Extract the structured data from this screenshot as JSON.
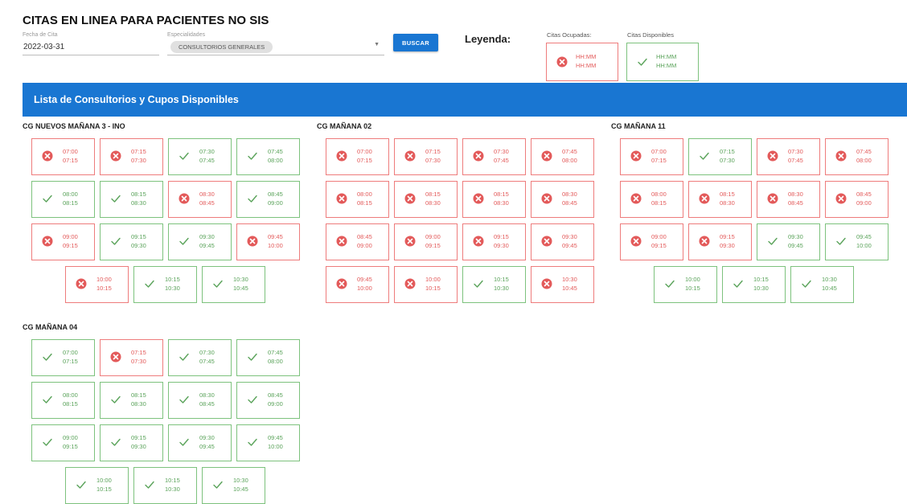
{
  "page": {
    "title": "CITAS EN LINEA PARA PACIENTES NO SIS"
  },
  "filters": {
    "date_label": "Fecha de Cita",
    "date_value": "2022-03-31",
    "specialty_label": "Especialidades",
    "specialty_value": "CONSULTORIOS GENERALES",
    "search_label": "BUSCAR"
  },
  "legend": {
    "title": "Leyenda:",
    "occupied_label": "Citas Ocupadas:",
    "occupied_start": "HH:MM",
    "occupied_end": "HH:MM",
    "available_label": "Citas Disponibles",
    "available_start": "HH:MM",
    "available_end": "HH:MM"
  },
  "banner": {
    "title": "Lista de Consultorios y Cupos Disponibles"
  },
  "colors": {
    "primary": "#1976d2",
    "occupied": "#e35a5a",
    "available": "#5aa35a"
  },
  "icons": {
    "occupied": "close-circle-icon",
    "available": "check-icon"
  },
  "groups": [
    {
      "name": "CG NUEVOS MAÑANA 3 - INO",
      "slots": [
        {
          "start": "07:00",
          "end": "07:15",
          "status": "occupied"
        },
        {
          "start": "07:15",
          "end": "07:30",
          "status": "occupied"
        },
        {
          "start": "07:30",
          "end": "07:45",
          "status": "available"
        },
        {
          "start": "07:45",
          "end": "08:00",
          "status": "available"
        },
        {
          "start": "08:00",
          "end": "08:15",
          "status": "available"
        },
        {
          "start": "08:15",
          "end": "08:30",
          "status": "available"
        },
        {
          "start": "08:30",
          "end": "08:45",
          "status": "occupied"
        },
        {
          "start": "08:45",
          "end": "09:00",
          "status": "available"
        },
        {
          "start": "09:00",
          "end": "09:15",
          "status": "occupied"
        },
        {
          "start": "09:15",
          "end": "09:30",
          "status": "available"
        },
        {
          "start": "09:30",
          "end": "09:45",
          "status": "available"
        },
        {
          "start": "09:45",
          "end": "10:00",
          "status": "occupied"
        },
        {
          "start": "10:00",
          "end": "10:15",
          "status": "occupied"
        },
        {
          "start": "10:15",
          "end": "10:30",
          "status": "available"
        },
        {
          "start": "10:30",
          "end": "10:45",
          "status": "available"
        }
      ]
    },
    {
      "name": "CG MAÑANA 02",
      "slots": [
        {
          "start": "07:00",
          "end": "07:15",
          "status": "occupied"
        },
        {
          "start": "07:15",
          "end": "07:30",
          "status": "occupied"
        },
        {
          "start": "07:30",
          "end": "07:45",
          "status": "occupied"
        },
        {
          "start": "07:45",
          "end": "08:00",
          "status": "occupied"
        },
        {
          "start": "08:00",
          "end": "08:15",
          "status": "occupied"
        },
        {
          "start": "08:15",
          "end": "08:30",
          "status": "occupied"
        },
        {
          "start": "08:15",
          "end": "08:30",
          "status": "occupied"
        },
        {
          "start": "08:30",
          "end": "08:45",
          "status": "occupied"
        },
        {
          "start": "08:45",
          "end": "09:00",
          "status": "occupied"
        },
        {
          "start": "09:00",
          "end": "09:15",
          "status": "occupied"
        },
        {
          "start": "09:15",
          "end": "09:30",
          "status": "occupied"
        },
        {
          "start": "09:30",
          "end": "09:45",
          "status": "occupied"
        },
        {
          "start": "09:45",
          "end": "10:00",
          "status": "occupied"
        },
        {
          "start": "10:00",
          "end": "10:15",
          "status": "occupied"
        },
        {
          "start": "10:15",
          "end": "10:30",
          "status": "available"
        },
        {
          "start": "10:30",
          "end": "10:45",
          "status": "occupied"
        }
      ]
    },
    {
      "name": "CG MAÑANA 11",
      "slots": [
        {
          "start": "07:00",
          "end": "07:15",
          "status": "occupied"
        },
        {
          "start": "07:15",
          "end": "07:30",
          "status": "available"
        },
        {
          "start": "07:30",
          "end": "07:45",
          "status": "occupied"
        },
        {
          "start": "07:45",
          "end": "08:00",
          "status": "occupied"
        },
        {
          "start": "08:00",
          "end": "08:15",
          "status": "occupied"
        },
        {
          "start": "08:15",
          "end": "08:30",
          "status": "occupied"
        },
        {
          "start": "08:30",
          "end": "08:45",
          "status": "occupied"
        },
        {
          "start": "08:45",
          "end": "09:00",
          "status": "occupied"
        },
        {
          "start": "09:00",
          "end": "09:15",
          "status": "occupied"
        },
        {
          "start": "09:15",
          "end": "09:30",
          "status": "occupied"
        },
        {
          "start": "09:30",
          "end": "09:45",
          "status": "available"
        },
        {
          "start": "09:45",
          "end": "10:00",
          "status": "available"
        },
        {
          "start": "10:00",
          "end": "10:15",
          "status": "available"
        },
        {
          "start": "10:15",
          "end": "10:30",
          "status": "available"
        },
        {
          "start": "10:30",
          "end": "10:45",
          "status": "available"
        }
      ]
    },
    {
      "name": "CG MAÑANA 04",
      "slots": [
        {
          "start": "07:00",
          "end": "07:15",
          "status": "available"
        },
        {
          "start": "07:15",
          "end": "07:30",
          "status": "occupied"
        },
        {
          "start": "07:30",
          "end": "07:45",
          "status": "available"
        },
        {
          "start": "07:45",
          "end": "08:00",
          "status": "available"
        },
        {
          "start": "08:00",
          "end": "08:15",
          "status": "available"
        },
        {
          "start": "08:15",
          "end": "08:30",
          "status": "available"
        },
        {
          "start": "08:30",
          "end": "08:45",
          "status": "available"
        },
        {
          "start": "08:45",
          "end": "09:00",
          "status": "available"
        },
        {
          "start": "09:00",
          "end": "09:15",
          "status": "available"
        },
        {
          "start": "09:15",
          "end": "09:30",
          "status": "available"
        },
        {
          "start": "09:30",
          "end": "09:45",
          "status": "available"
        },
        {
          "start": "09:45",
          "end": "10:00",
          "status": "available"
        },
        {
          "start": "10:00",
          "end": "10:15",
          "status": "available"
        },
        {
          "start": "10:15",
          "end": "10:30",
          "status": "available"
        },
        {
          "start": "10:30",
          "end": "10:45",
          "status": "available"
        }
      ]
    }
  ]
}
